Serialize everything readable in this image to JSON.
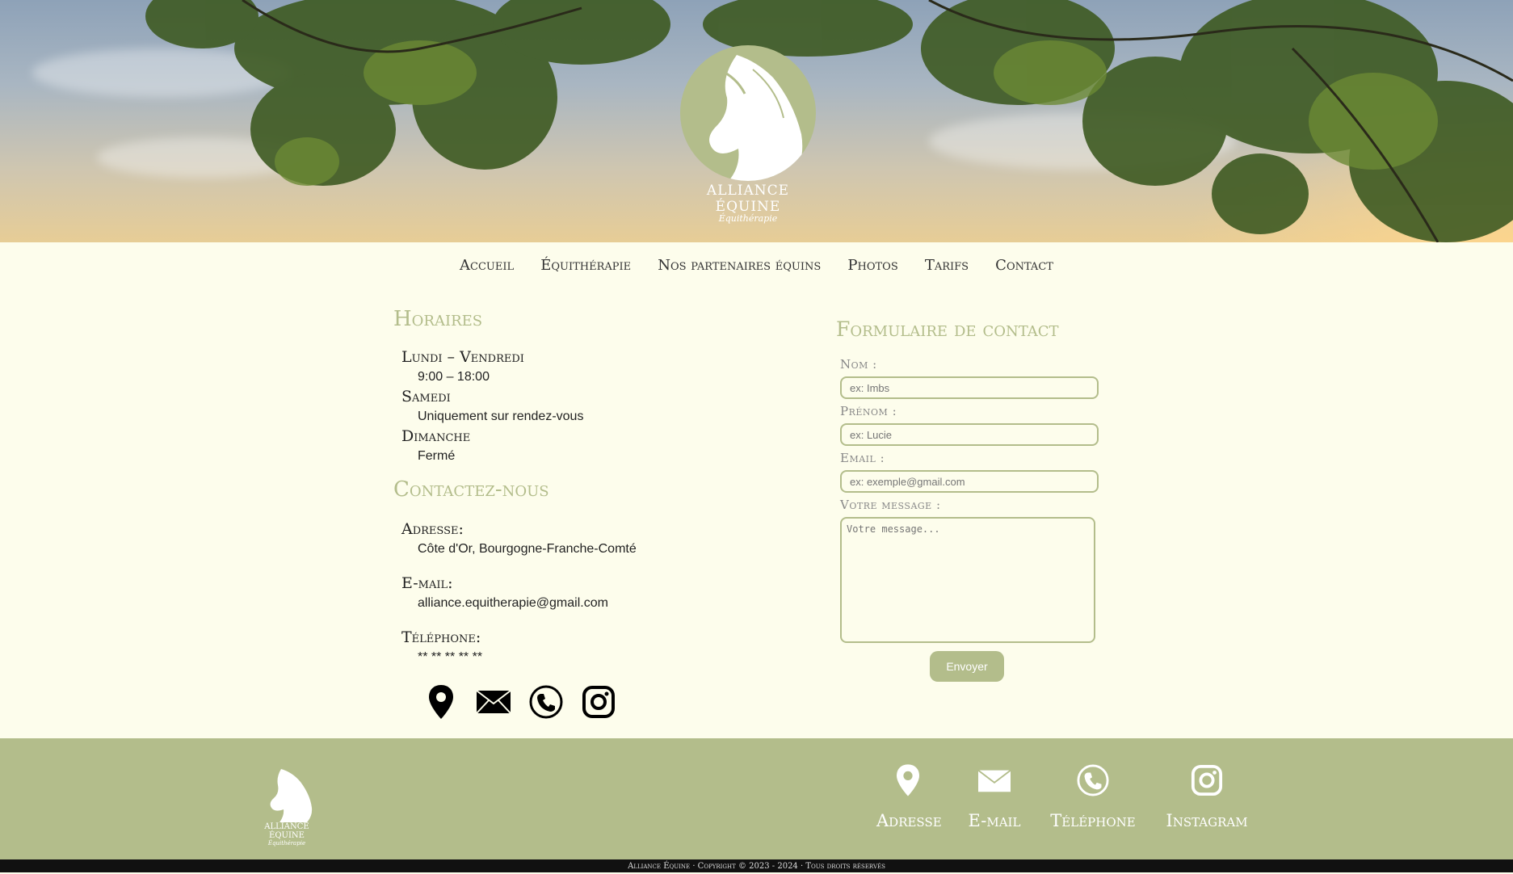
{
  "brand": {
    "name": "ALLIANCE ÉQUINE",
    "subtitle": "Équithérapie"
  },
  "nav": [
    "Accueil",
    "Équithérapie",
    "Nos partenaires équins",
    "Photos",
    "Tarifs",
    "Contact"
  ],
  "hours": {
    "title": "Horaires",
    "rows": [
      {
        "day": "Lundi – Vendredi",
        "time": "9:00 – 18:00"
      },
      {
        "day": "Samedi",
        "time": "Uniquement sur rendez-vous"
      },
      {
        "day": "Dimanche",
        "time": "Fermé"
      }
    ]
  },
  "contact": {
    "title": "Contactez-nous",
    "address_label": "Adresse:",
    "address": "Côte d'Or, Bourgogne-Franche-Comté",
    "email_label": "E-mail:",
    "email": "alliance.equitherapie@gmail.com",
    "phone_label": "Téléphone:",
    "phone": "** ** ** ** **",
    "icons": [
      "location-pin-icon",
      "envelope-icon",
      "phone-icon",
      "instagram-icon"
    ]
  },
  "form": {
    "title": "Formulaire de contact",
    "nom_label": "Nom :",
    "nom_placeholder": "ex: Imbs",
    "prenom_label": "Prénom :",
    "prenom_placeholder": "ex: Lucie",
    "email_label": "Email :",
    "email_placeholder": "ex: exemple@gmail.com",
    "message_label": "Votre message :",
    "message_placeholder": "Votre message...",
    "submit": "Envoyer"
  },
  "footer": {
    "logo_name": "ALLIANCE ÉQUINE",
    "logo_sub": "Équithérapie",
    "items": [
      "Adresse",
      "E-mail",
      "Téléphone",
      "Instagram"
    ],
    "copyright": "Alliance Équine · Copyright © 2023 - 2024 · Tous droits réservés"
  },
  "colors": {
    "accent": "#b3bd8b",
    "background": "#fdfdec",
    "text": "#222222",
    "bottom_bar": "#111111"
  }
}
